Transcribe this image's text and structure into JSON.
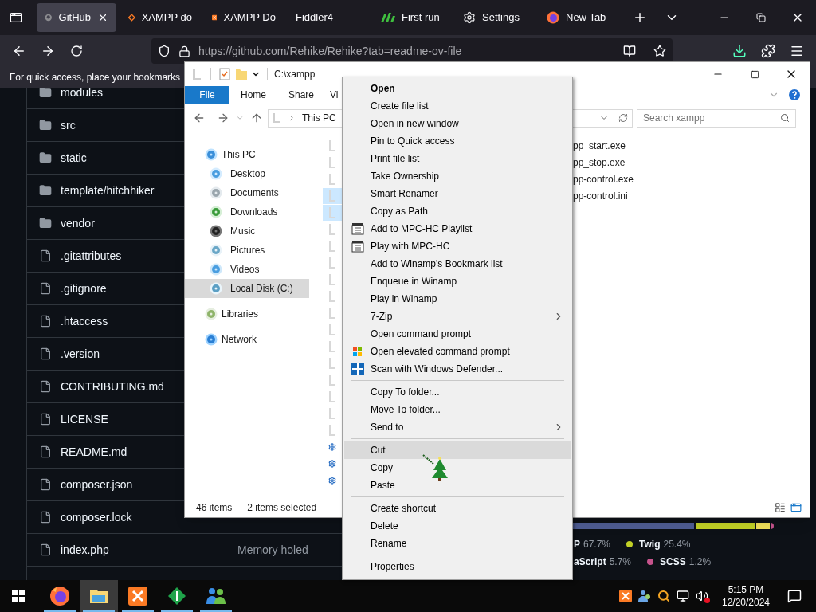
{
  "browser": {
    "tabs": [
      {
        "label": "GitHub",
        "kind": "github",
        "selected": true
      },
      {
        "label": "XAMPP do",
        "kind": "xampp-outline",
        "selected": false
      },
      {
        "label": "XAMPP Do",
        "kind": "xampp",
        "selected": false
      },
      {
        "label": "Fiddler4",
        "kind": "none",
        "selected": false
      },
      {
        "label": "First run",
        "kind": "bars",
        "selected": false
      },
      {
        "label": "Settings",
        "kind": "gear",
        "selected": false
      },
      {
        "label": "New Tab",
        "kind": "firefox",
        "selected": false
      }
    ],
    "url": "https://github.com/Rehike/Rehike?tab=readme-ov-file",
    "bookmarks_hint": "For quick access, place your bookmarks"
  },
  "repo": {
    "files": [
      {
        "name": "modules",
        "kind": "folder"
      },
      {
        "name": "src",
        "kind": "folder"
      },
      {
        "name": "static",
        "kind": "folder"
      },
      {
        "name": "template/hitchhiker",
        "kind": "folder"
      },
      {
        "name": "vendor",
        "kind": "folder"
      },
      {
        "name": ".gitattributes",
        "kind": "file"
      },
      {
        "name": ".gitignore",
        "kind": "file"
      },
      {
        "name": ".htaccess",
        "kind": "file"
      },
      {
        "name": ".version",
        "kind": "file"
      },
      {
        "name": "CONTRIBUTING.md",
        "kind": "file"
      },
      {
        "name": "LICENSE",
        "kind": "file"
      },
      {
        "name": "README.md",
        "kind": "file"
      },
      {
        "name": "composer.json",
        "kind": "file"
      },
      {
        "name": "composer.lock",
        "kind": "file"
      },
      {
        "name": "index.php",
        "kind": "file",
        "commit": "Memory holed"
      }
    ],
    "language_bar": [
      {
        "color": "#4f5d95"
      },
      {
        "color": "#c1d026"
      },
      {
        "color": "#f1e05a"
      },
      {
        "color": "#c6538c"
      }
    ],
    "languages": [
      {
        "name": "P",
        "percent": "67.7%"
      },
      {
        "name": "Twig",
        "percent": "25.4%",
        "color": "#c1d026"
      },
      {
        "name": "aScript",
        "percent": "5.7%"
      },
      {
        "name": "SCSS",
        "percent": "1.2%",
        "color": "#c6538c"
      }
    ]
  },
  "explorer": {
    "path": "C:\\xampp",
    "ribbon_tabs": [
      {
        "label": "File",
        "selected": true
      },
      {
        "label": "Home",
        "selected": false
      },
      {
        "label": "Share",
        "selected": false
      },
      {
        "label": "Vi",
        "selected": false
      }
    ],
    "address": "This PC",
    "search": {
      "placeholder": "Search xampp"
    },
    "nav": [
      {
        "label": "This PC",
        "kind": "pc",
        "selected": false,
        "children": [
          {
            "label": "Desktop",
            "kind": "desktop",
            "selected": false
          },
          {
            "label": "Documents",
            "kind": "documents",
            "selected": false
          },
          {
            "label": "Downloads",
            "kind": "downloads",
            "selected": false
          },
          {
            "label": "Music",
            "kind": "music",
            "selected": false
          },
          {
            "label": "Pictures",
            "kind": "pictures",
            "selected": false
          },
          {
            "label": "Videos",
            "kind": "videos",
            "selected": false
          },
          {
            "label": "Local Disk (C:)",
            "kind": "disk",
            "selected": true
          }
        ]
      },
      {
        "label": "Libraries",
        "kind": "libraries",
        "selected": false
      },
      {
        "label": "Network",
        "kind": "network",
        "selected": false
      }
    ],
    "files": [
      {
        "name": "pp_start.exe",
        "kind": "shortcut",
        "selected": false
      },
      {
        "name": "pp_stop.exe",
        "kind": "shortcut",
        "selected": false
      },
      {
        "name": "pp-control.exe",
        "kind": "shortcut",
        "selected": false
      },
      {
        "name": "pp-control.ini",
        "kind": "shortcut",
        "selected": true
      },
      {
        "kind": "shortcut",
        "selected": true
      },
      {
        "kind": "shortcut",
        "selected": false
      },
      {
        "kind": "shortcut",
        "selected": false
      },
      {
        "kind": "shortcut",
        "selected": false
      },
      {
        "kind": "shortcut",
        "selected": false
      },
      {
        "kind": "shortcut",
        "selected": false
      },
      {
        "kind": "shortcut",
        "selected": false
      },
      {
        "kind": "shortcut",
        "selected": false
      },
      {
        "kind": "shortcut",
        "selected": false
      },
      {
        "kind": "shortcut",
        "selected": false
      },
      {
        "kind": "shortcut",
        "selected": false
      },
      {
        "kind": "shortcut",
        "selected": false
      },
      {
        "kind": "shortcut",
        "selected": false
      },
      {
        "kind": "shortcut",
        "selected": false
      },
      {
        "kind": "gear",
        "selected": false
      },
      {
        "kind": "gear",
        "selected": false
      },
      {
        "kind": "gear",
        "selected": false
      }
    ],
    "status": {
      "count": "46 items",
      "selection": "2 items selected"
    }
  },
  "context_menu": [
    {
      "kind": "plain",
      "label": "Open",
      "default": true,
      "selected": false,
      "submenu": false
    },
    {
      "kind": "plain",
      "label": "Create file list",
      "default": false,
      "selected": false,
      "submenu": false
    },
    {
      "kind": "plain",
      "label": "Open in new window",
      "default": false,
      "selected": false,
      "submenu": false
    },
    {
      "kind": "plain",
      "label": "Pin to Quick access",
      "default": false,
      "selected": false,
      "submenu": false
    },
    {
      "kind": "plain",
      "label": "Print file list",
      "default": false,
      "selected": false,
      "submenu": false
    },
    {
      "kind": "plain",
      "label": "Take Ownership",
      "default": false,
      "selected": false,
      "submenu": false
    },
    {
      "kind": "plain",
      "label": "Smart Renamer",
      "default": false,
      "selected": false,
      "submenu": false
    },
    {
      "kind": "plain",
      "label": "Copy as Path",
      "default": false,
      "selected": false,
      "submenu": false
    },
    {
      "kind": "film",
      "label": "Add to MPC-HC Playlist",
      "default": false,
      "selected": false,
      "submenu": false
    },
    {
      "kind": "film",
      "label": "Play with MPC-HC",
      "default": false,
      "selected": false,
      "submenu": false
    },
    {
      "kind": "plain",
      "label": "Add to Winamp's Bookmark list",
      "default": false,
      "selected": false,
      "submenu": false
    },
    {
      "kind": "plain",
      "label": "Enqueue in Winamp",
      "default": false,
      "selected": false,
      "submenu": false
    },
    {
      "kind": "plain",
      "label": "Play in Winamp",
      "default": false,
      "selected": false,
      "submenu": false
    },
    {
      "kind": "plain",
      "label": "7-Zip",
      "default": false,
      "selected": false,
      "submenu": true
    },
    {
      "kind": "plain",
      "label": "Open command prompt",
      "default": false,
      "selected": false,
      "submenu": false
    },
    {
      "kind": "flag",
      "label": "Open elevated command prompt",
      "default": false,
      "selected": false,
      "submenu": false
    },
    {
      "kind": "defender",
      "label": "Scan with Windows Defender...",
      "default": false,
      "selected": false,
      "submenu": false
    },
    {
      "kind": "separator"
    },
    {
      "kind": "plain",
      "label": "Copy To folder...",
      "default": false,
      "selected": false,
      "submenu": false
    },
    {
      "kind": "plain",
      "label": "Move To folder...",
      "default": false,
      "selected": false,
      "submenu": false
    },
    {
      "kind": "plain",
      "label": "Send to",
      "default": false,
      "selected": false,
      "submenu": true
    },
    {
      "kind": "separator"
    },
    {
      "kind": "plain",
      "label": "Cut",
      "default": false,
      "selected": true,
      "submenu": false
    },
    {
      "kind": "plain",
      "label": "Copy",
      "default": false,
      "selected": false,
      "submenu": false
    },
    {
      "kind": "plain",
      "label": "Paste",
      "default": false,
      "selected": false,
      "submenu": false
    },
    {
      "kind": "separator"
    },
    {
      "kind": "plain",
      "label": "Create shortcut",
      "default": false,
      "selected": false,
      "submenu": false
    },
    {
      "kind": "plain",
      "label": "Delete",
      "default": false,
      "selected": false,
      "submenu": false
    },
    {
      "kind": "plain",
      "label": "Rename",
      "default": false,
      "selected": false,
      "submenu": false
    },
    {
      "kind": "separator"
    },
    {
      "kind": "plain",
      "label": "Properties",
      "default": false,
      "selected": false,
      "submenu": false
    }
  ],
  "taskbar": {
    "apps": [
      {
        "kind": "firefox",
        "active": false,
        "open": true
      },
      {
        "kind": "folder",
        "active": true,
        "open": true
      },
      {
        "kind": "xampp",
        "active": false,
        "open": true
      },
      {
        "kind": "diamond",
        "active": false,
        "open": true
      },
      {
        "kind": "people",
        "active": false,
        "open": true
      }
    ],
    "time": "5:15 PM",
    "date": "12/20/2024"
  }
}
